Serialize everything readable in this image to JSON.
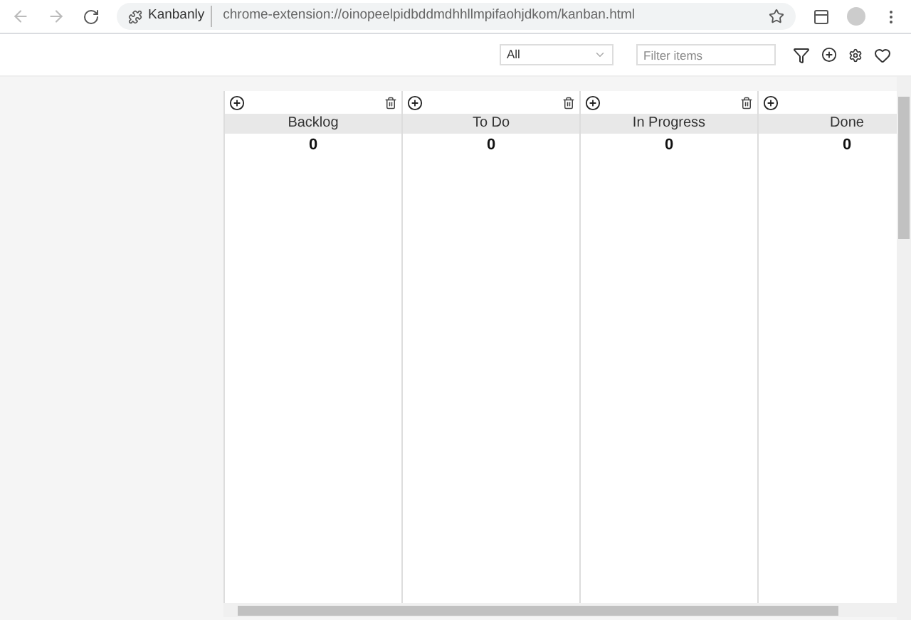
{
  "browser": {
    "site_name": "Kanbanly",
    "url": "chrome-extension://oinopeelpidbddmdhhllmpifaohjdkom/kanban.html"
  },
  "toolbar": {
    "filter_select": {
      "value": "All"
    },
    "filter_input": {
      "placeholder": "Filter items"
    }
  },
  "columns": [
    {
      "title": "Backlog",
      "count": "0"
    },
    {
      "title": "To Do",
      "count": "0"
    },
    {
      "title": "In Progress",
      "count": "0"
    },
    {
      "title": "Done",
      "count": "0"
    }
  ]
}
